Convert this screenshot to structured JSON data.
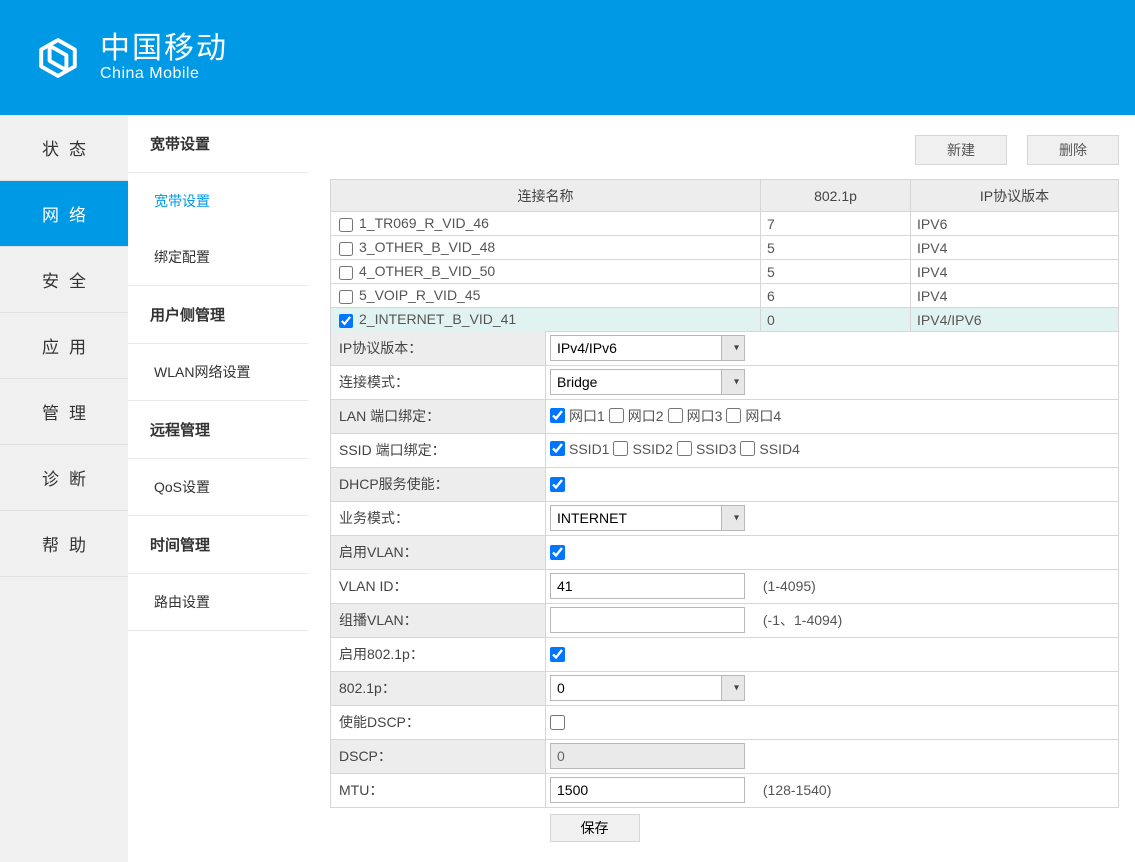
{
  "brand": {
    "cn": "中国移动",
    "en": "China Mobile"
  },
  "nav_main": [
    "状态",
    "网络",
    "安全",
    "应用",
    "管理",
    "诊断",
    "帮助"
  ],
  "nav_sub": {
    "group1_title": "宽带设置",
    "group1_items": [
      "宽带设置",
      "绑定配置"
    ],
    "group2_title": "用户侧管理",
    "group2_items": [
      "WLAN网络设置"
    ],
    "group3_title": "远程管理",
    "group3_items": [
      "QoS设置"
    ],
    "group4_title": "时间管理",
    "group4_items": [
      "路由设置"
    ]
  },
  "actions": {
    "new": "新建",
    "delete": "删除"
  },
  "table_headers": {
    "name": "连接名称",
    "p8021": "802.1p",
    "ipver": "IP协议版本"
  },
  "connections": [
    {
      "checked": false,
      "name": "1_TR069_R_VID_46",
      "p": "7",
      "ip": "IPV6"
    },
    {
      "checked": false,
      "name": "3_OTHER_B_VID_48",
      "p": "5",
      "ip": "IPV4"
    },
    {
      "checked": false,
      "name": "4_OTHER_B_VID_50",
      "p": "5",
      "ip": "IPV4"
    },
    {
      "checked": false,
      "name": "5_VOIP_R_VID_45",
      "p": "6",
      "ip": "IPV4"
    },
    {
      "checked": true,
      "name": "2_INTERNET_B_VID_41",
      "p": "0",
      "ip": "IPV4/IPV6"
    }
  ],
  "form": {
    "ip_proto_label": "IP协议版本：",
    "ip_proto_value": "IPv4/IPv6",
    "conn_mode_label": "连接模式：",
    "conn_mode_value": "Bridge",
    "lan_bind_label": "LAN 端口绑定：",
    "lan_ports": [
      {
        "label": "网口1",
        "checked": true
      },
      {
        "label": "网口2",
        "checked": false
      },
      {
        "label": "网口3",
        "checked": false
      },
      {
        "label": "网口4",
        "checked": false
      }
    ],
    "ssid_bind_label": "SSID 端口绑定：",
    "ssids": [
      {
        "label": "SSID1",
        "checked": true
      },
      {
        "label": "SSID2",
        "checked": false
      },
      {
        "label": "SSID3",
        "checked": false
      },
      {
        "label": "SSID4",
        "checked": false
      }
    ],
    "dhcp_label": "DHCP服务使能：",
    "dhcp_checked": true,
    "svc_mode_label": "业务模式：",
    "svc_mode_value": "INTERNET",
    "vlan_enable_label": "启用VLAN：",
    "vlan_enable_checked": true,
    "vlan_id_label": "VLAN ID：",
    "vlan_id_value": "41",
    "vlan_id_hint": "(1-4095)",
    "mcast_vlan_label": "组播VLAN：",
    "mcast_vlan_value": "",
    "mcast_vlan_hint": "(-1、1-4094)",
    "p8021_enable_label": "启用802.1p：",
    "p8021_enable_checked": true,
    "p8021_label": "802.1p：",
    "p8021_value": "0",
    "dscp_enable_label": "使能DSCP：",
    "dscp_enable_checked": false,
    "dscp_label": "DSCP：",
    "dscp_value": "0",
    "mtu_label": "MTU：",
    "mtu_value": "1500",
    "mtu_hint": "(128-1540)",
    "save": "保存"
  }
}
